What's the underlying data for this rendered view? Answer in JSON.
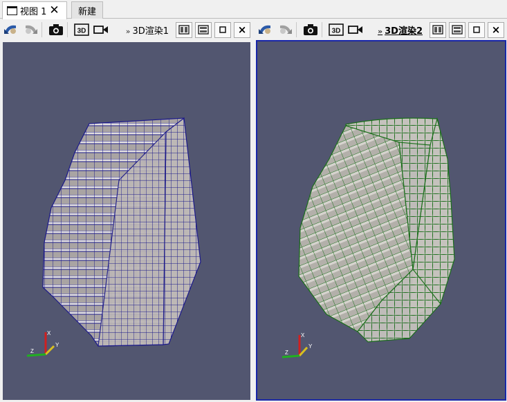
{
  "tabs": {
    "active": {
      "label": "视图 1",
      "close": "✕"
    },
    "new": {
      "label": "新建"
    }
  },
  "left_view": {
    "title": "3D渲染1",
    "chevron": "»",
    "toolbar_icons": [
      "reset-camera-icon",
      "redo-camera-icon",
      "camera-capture-icon",
      "3d-toggle-icon",
      "camera-record-icon"
    ],
    "label_3d": "3D",
    "frame_buttons": [
      "split-horizontal-icon",
      "split-vertical-icon",
      "maximize-icon",
      "close-icon"
    ],
    "close_glyph": "×",
    "mesh_color": "#1c1a8a"
  },
  "right_view": {
    "title": "3D渲染2",
    "chevron": "»",
    "label_3d": "3D",
    "close_glyph": "×",
    "mesh_color": "#1a6e1a"
  },
  "axes": {
    "x": "X",
    "y": "Y",
    "z": "Z"
  },
  "colors": {
    "background": "#525670",
    "active_border": "#1826a8",
    "surface": "#b9b4b2"
  }
}
